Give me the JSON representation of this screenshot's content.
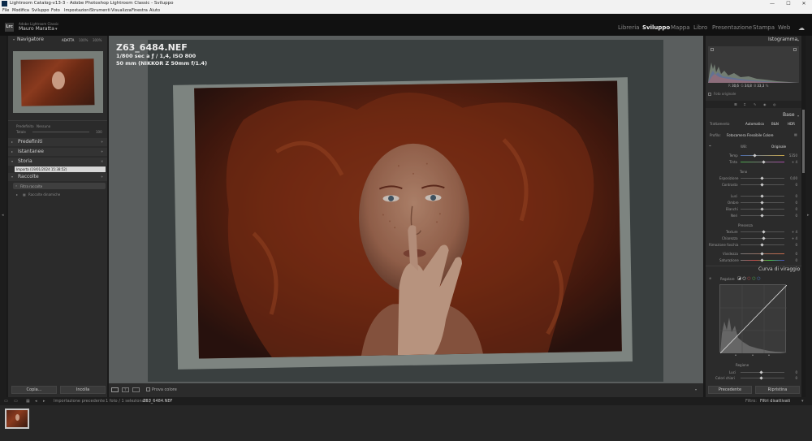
{
  "window": {
    "title": "Lightroom Catalog-v13-3 - Adobe Photoshop Lightroom Classic - Sviluppo",
    "minimize": "—",
    "maximize": "☐",
    "close": "✕"
  },
  "menu": [
    "File",
    "Modifica",
    "Sviluppo",
    "Foto",
    "Impostazioni",
    "Strumenti",
    "Visualizza",
    "Finestra",
    "Aiuto"
  ],
  "identity": {
    "logo": "Lrc",
    "product": "Adobe Lightroom Classic",
    "user": "Mauro Maratta"
  },
  "modules": {
    "libreria": "Libreria",
    "sviluppo": "Sviluppo",
    "mappa": "Mappa",
    "libro": "Libro",
    "presentazione": "Presentazione",
    "stampa": "Stampa",
    "web": "Web",
    "active": "Sviluppo"
  },
  "left": {
    "navigator": {
      "title": "Navigatore",
      "zoom_fit": "ADATTA",
      "zoom_100": "100%",
      "zoom_300": "300%"
    },
    "preview": {
      "label_left": "Predefinito",
      "label_right": "Nessuno",
      "amount": "Totale",
      "value": "100"
    },
    "predefiniti": "Predefiniti",
    "istantanee": "Istantanee",
    "storia": {
      "title": "Storia",
      "item": "Importa (19/01/2024 15:38:52)"
    },
    "raccolte": {
      "title": "Raccolte",
      "filter": "Filtra raccolte",
      "smart": "Raccolte dinamiche"
    },
    "copy_button": "Copia...",
    "paste_button": "Incolla"
  },
  "photo": {
    "filename": "Z63_6484.NEF",
    "exposure": "1/800 sec a ƒ / 1,4, ISO 800",
    "lens": "50 mm (NIKKOR Z 50mm f/1.4)"
  },
  "toolbar": {
    "soft_proof": "Prova colore"
  },
  "filmstrip_bar": {
    "source": "Importazione precedente",
    "count": "1 foto / 1 selezionato /",
    "current": "Z63_6484.NEF",
    "filter_label": "Filtro:",
    "filter_value": "Filtri disattivati"
  },
  "right": {
    "istogramma": {
      "title": "Istogramma",
      "r": "R",
      "r_val": "30,6",
      "g": "G",
      "g_val": "34,8",
      "b": "B",
      "b_val": "33,3",
      "pct": "%",
      "original_photo": "Foto originale"
    },
    "base": {
      "title": "Base",
      "trattamento": "Trattamento",
      "colore": "Colore",
      "bn": "B&N",
      "automatico": "Automatico",
      "hdr": "HDR",
      "profilo_label": "Profilo:",
      "profilo": "Fotocamera Flessibile Colore",
      "wb_label": "WB:",
      "wb": "Originale",
      "temp": "Temp",
      "temp_val": "5350",
      "tinta": "Tinta",
      "tinta_val": "+ 4",
      "tono": "Tono",
      "esposizione": "Esposizione",
      "esposizione_val": "0,00",
      "contrasto": "Contrasto",
      "contrasto_val": "0",
      "luci": "Luci",
      "luci_val": "0",
      "ombre": "Ombre",
      "ombre_val": "0",
      "bianchi": "Bianchi",
      "bianchi_val": "0",
      "neri": "Neri",
      "neri_val": "0",
      "presenza": "Presenza",
      "texture": "Texture",
      "texture_val": "+ 4",
      "chiarezza": "Chiarezza",
      "chiarezza_val": "+ 4",
      "foschia": "Rimozione foschia",
      "foschia_val": "0",
      "vividezza": "Vividezza",
      "vividezza_val": "0",
      "saturazione": "Saturazione",
      "saturazione_val": "0"
    },
    "curva": {
      "title": "Curva di viraggio",
      "regolare": "Regolare",
      "regione": "Regione",
      "luci": "Luci",
      "luci_val": "0",
      "colori": "Colori chiari",
      "colori_val": "0"
    },
    "precedente_button": "Precedente",
    "ripristina_button": "Ripristina"
  },
  "colors": {
    "bg": "#1a1a1a",
    "panel": "#2b2b2b",
    "canvas": "#5a5e5e",
    "accent": "#ffffff"
  }
}
